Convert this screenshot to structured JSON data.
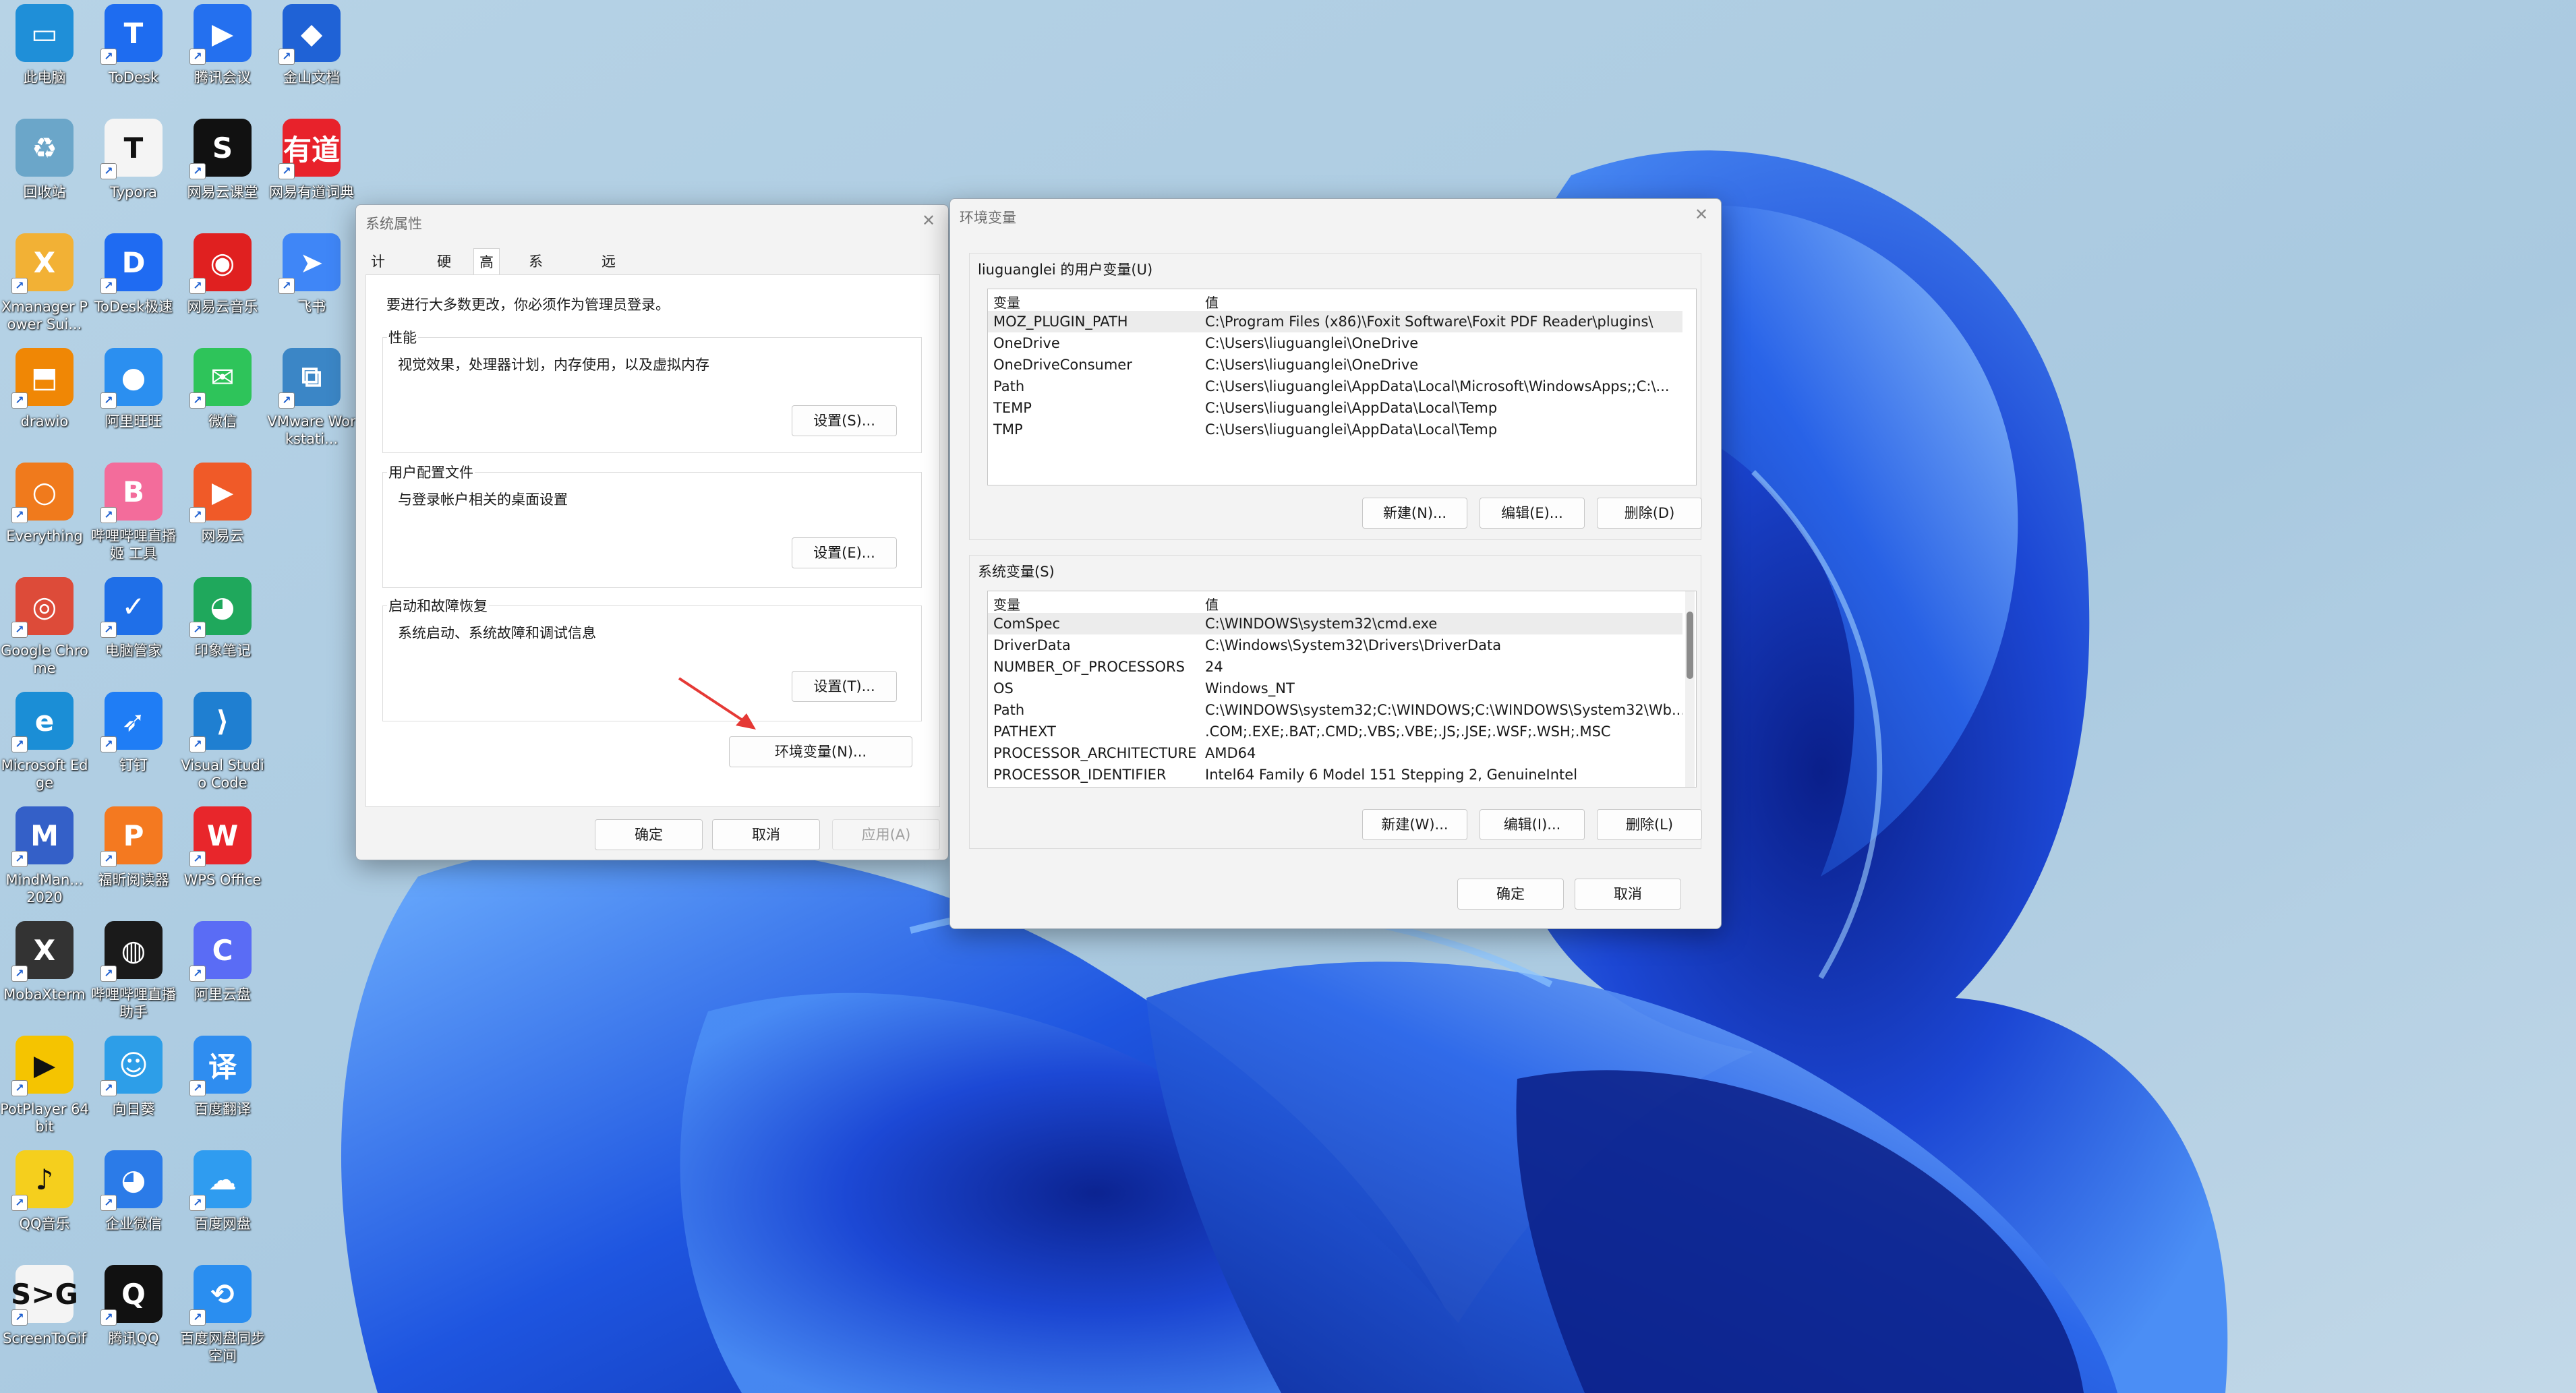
{
  "desktop": {
    "icons": [
      {
        "label": "此电脑",
        "glyph": "▭",
        "color": "#1f8fd8"
      },
      {
        "label": "ToDesk",
        "glyph": "T",
        "color": "#1e6cf0"
      },
      {
        "label": "腾讯会议",
        "glyph": "▶",
        "color": "#2470ef"
      },
      {
        "label": "金山文档",
        "glyph": "◆",
        "color": "#1f62d6"
      },
      {
        "label": "回收站",
        "glyph": "♻",
        "color": "#6ba6c9"
      },
      {
        "label": "Typora",
        "glyph": "T",
        "color": "#f4f4f4"
      },
      {
        "label": "网易云课堂",
        "glyph": "S",
        "color": "#111111"
      },
      {
        "label": "网易有道词典",
        "glyph": "有道",
        "color": "#e8222b"
      },
      {
        "label": "Xmanager Power Sui...",
        "glyph": "X",
        "color": "#f2b135"
      },
      {
        "label": "ToDesk极速",
        "glyph": "D",
        "color": "#1f6bf2"
      },
      {
        "label": "网易云音乐",
        "glyph": "◉",
        "color": "#e02020"
      },
      {
        "label": "飞书",
        "glyph": "➤",
        "color": "#3f86f7"
      },
      {
        "label": "drawio",
        "glyph": "⬒",
        "color": "#f08705"
      },
      {
        "label": "阿里旺旺",
        "glyph": "●",
        "color": "#2b8ff0"
      },
      {
        "label": "微信",
        "glyph": "✉",
        "color": "#2ec45a"
      },
      {
        "label": "VMware Workstati...",
        "glyph": "⧉",
        "color": "#3b86c6"
      },
      {
        "label": "Everything",
        "glyph": "○",
        "color": "#f07a1c"
      },
      {
        "label": "哔哩哔哩直播姬 工具",
        "glyph": "B",
        "color": "#f36c9b"
      },
      {
        "label": "网易云",
        "glyph": "▶",
        "color": "#f05a28"
      },
      {
        "label": "Google Chrome",
        "glyph": "◎",
        "color": "#dd4b39"
      },
      {
        "label": "电脑管家",
        "glyph": "✓",
        "color": "#1f6fe8"
      },
      {
        "label": "印象笔记",
        "glyph": "◕",
        "color": "#1fa85c"
      },
      {
        "label": "Microsoft Edge",
        "glyph": "e",
        "color": "#1b8ed6"
      },
      {
        "label": "钉钉",
        "glyph": "➶",
        "color": "#1f7df5"
      },
      {
        "label": "Visual Studio Code",
        "glyph": "⟩",
        "color": "#1f7fd1"
      },
      {
        "label": "MindMan... 2020",
        "glyph": "M",
        "color": "#3460c8"
      },
      {
        "label": "福昕阅读器",
        "glyph": "P",
        "color": "#f47920"
      },
      {
        "label": "WPS Office",
        "glyph": "W",
        "color": "#e8262b"
      },
      {
        "label": "MobaXterm",
        "glyph": "X",
        "color": "#333333"
      },
      {
        "label": "哔哩哔哩直播 助手",
        "glyph": "◍",
        "color": "#1a1a1a"
      },
      {
        "label": "阿里云盘",
        "glyph": "C",
        "color": "#5a6cf5"
      },
      {
        "label": "PotPlayer 64 bit",
        "glyph": "▶",
        "color": "#f5c400"
      },
      {
        "label": "向日葵",
        "glyph": "☺",
        "color": "#2d9ee8"
      },
      {
        "label": "百度翻译",
        "glyph": "译",
        "color": "#2f8df0"
      },
      {
        "label": "QQ音乐",
        "glyph": "♪",
        "color": "#f5cf1d"
      },
      {
        "label": "企业微信",
        "glyph": "◕",
        "color": "#2b7be8"
      },
      {
        "label": "百度网盘",
        "glyph": "☁",
        "color": "#2f9cf0"
      },
      {
        "label": "ScreenToGif",
        "glyph": "S>G",
        "color": "#f4f4f4"
      },
      {
        "label": "腾讯QQ",
        "glyph": "Q",
        "color": "#111111"
      },
      {
        "label": "百度网盘同步 空间",
        "glyph": "⟲",
        "color": "#2a8ef0"
      }
    ]
  },
  "sysprops": {
    "title": "系统属性",
    "close_icon": "✕",
    "tabs": [
      "计算机名",
      "硬件",
      "高级",
      "系统保护",
      "远程"
    ],
    "admin_notice": "要进行大多数更改，你必须作为管理员登录。",
    "performance": {
      "title": "性能",
      "desc": "视觉效果，处理器计划，内存使用，以及虚拟内存",
      "button": "设置(S)..."
    },
    "profile": {
      "title": "用户配置文件",
      "desc": "与登录帐户相关的桌面设置",
      "button": "设置(E)..."
    },
    "startup": {
      "title": "启动和故障恢复",
      "desc": "系统启动、系统故障和调试信息",
      "button": "设置(T)..."
    },
    "env_button": "环境变量(N)...",
    "ok": "确定",
    "cancel": "取消",
    "apply": "应用(A)"
  },
  "envvars": {
    "title": "环境变量",
    "close_icon": "✕",
    "user_section": "liuguanglei 的用户变量(U)",
    "col_var": "变量",
    "col_val": "值",
    "user_vars": [
      {
        "name": "MOZ_PLUGIN_PATH",
        "value": "C:\\Program Files (x86)\\Foxit Software\\Foxit PDF Reader\\plugins\\"
      },
      {
        "name": "OneDrive",
        "value": "C:\\Users\\liuguanglei\\OneDrive"
      },
      {
        "name": "OneDriveConsumer",
        "value": "C:\\Users\\liuguanglei\\OneDrive"
      },
      {
        "name": "Path",
        "value": "C:\\Users\\liuguanglei\\AppData\\Local\\Microsoft\\WindowsApps;;C:\\..."
      },
      {
        "name": "TEMP",
        "value": "C:\\Users\\liuguanglei\\AppData\\Local\\Temp"
      },
      {
        "name": "TMP",
        "value": "C:\\Users\\liuguanglei\\AppData\\Local\\Temp"
      }
    ],
    "user_buttons": {
      "new": "新建(N)...",
      "edit": "编辑(E)...",
      "delete": "删除(D)"
    },
    "sys_section": "系统变量(S)",
    "sys_vars": [
      {
        "name": "ComSpec",
        "value": "C:\\WINDOWS\\system32\\cmd.exe"
      },
      {
        "name": "DriverData",
        "value": "C:\\Windows\\System32\\Drivers\\DriverData"
      },
      {
        "name": "NUMBER_OF_PROCESSORS",
        "value": "24"
      },
      {
        "name": "OS",
        "value": "Windows_NT"
      },
      {
        "name": "Path",
        "value": "C:\\WINDOWS\\system32;C:\\WINDOWS;C:\\WINDOWS\\System32\\Wb..."
      },
      {
        "name": "PATHEXT",
        "value": ".COM;.EXE;.BAT;.CMD;.VBS;.VBE;.JS;.JSE;.WSF;.WSH;.MSC"
      },
      {
        "name": "PROCESSOR_ARCHITECTURE",
        "value": "AMD64"
      },
      {
        "name": "PROCESSOR_IDENTIFIER",
        "value": "Intel64 Family 6 Model 151 Stepping 2, GenuineIntel"
      }
    ],
    "sys_buttons": {
      "new": "新建(W)...",
      "edit": "编辑(I)...",
      "delete": "删除(L)"
    },
    "ok": "确定",
    "cancel": "取消"
  },
  "colors": {
    "annotation_arrow": "#e53935",
    "wallpaper_blue": "#1f4fd6"
  }
}
